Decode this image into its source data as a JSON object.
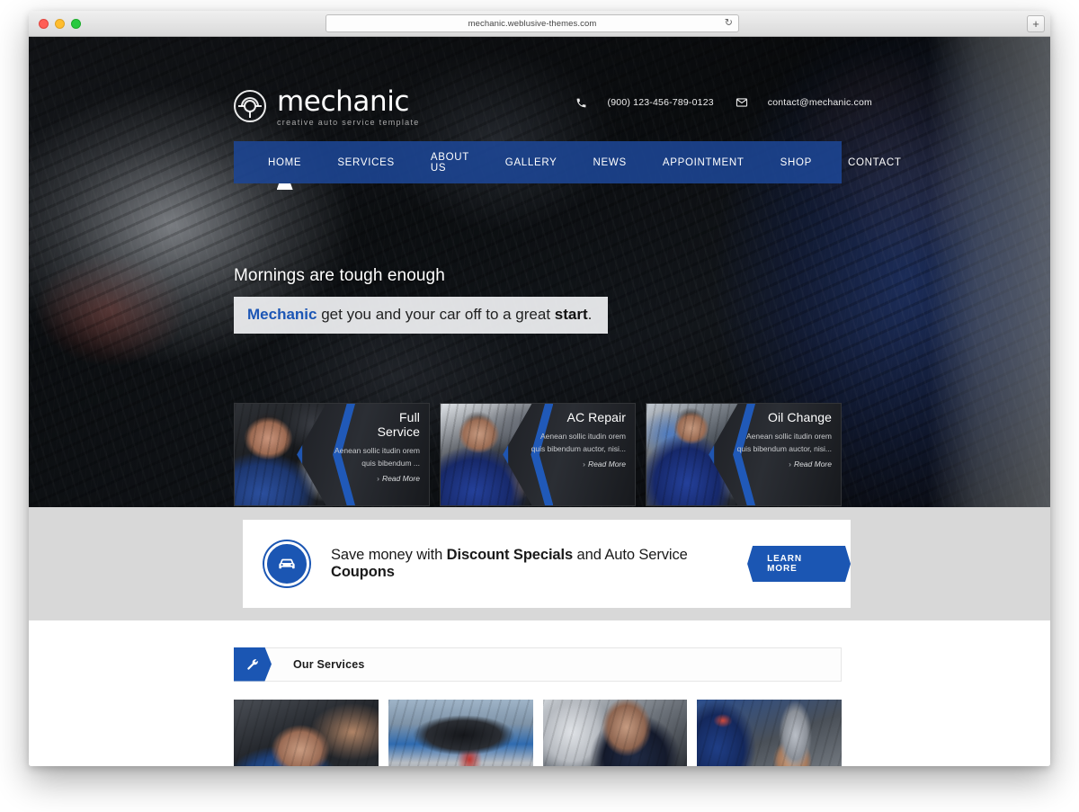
{
  "browser": {
    "url": "mechanic.weblusive-themes.com",
    "reload_icon": "reload-icon",
    "new_tab_label": "+",
    "traffic_lights": [
      "close",
      "minimize",
      "maximize"
    ]
  },
  "site": {
    "logo_name": "mechanic",
    "logo_tagline": "creative auto service template",
    "logo_icon": "steering-wheel-icon",
    "contact": {
      "phone_icon": "phone-icon",
      "phone": "(900) 123-456-789-0123",
      "email_icon": "envelope-icon",
      "email": "contact@mechanic.com"
    },
    "nav": [
      {
        "label": "HOME",
        "active": true
      },
      {
        "label": "SERVICES",
        "active": false
      },
      {
        "label": "ABOUT US",
        "active": false
      },
      {
        "label": "GALLERY",
        "active": false
      },
      {
        "label": "NEWS",
        "active": false
      },
      {
        "label": "APPOINTMENT",
        "active": false
      },
      {
        "label": "SHOP",
        "active": false
      },
      {
        "label": "CONTACT",
        "active": false
      }
    ],
    "accent_color": "#1b56b3",
    "nav_color": "#1d4694",
    "band_color": "#d8d8d8"
  },
  "hero": {
    "line1": "Mornings are tough enough",
    "caption_brand": "Mechanic",
    "caption_mid": " get you and your car off to a great ",
    "caption_kw": "start",
    "caption_end": "."
  },
  "cards": [
    {
      "title": "Full Service",
      "title_l1": "Full",
      "title_l2": "Service",
      "desc": "Aenean sollic itudin orem quis bibendum  ...",
      "more": "Read More",
      "more_chevron": "›"
    },
    {
      "title": "AC Repair",
      "title_l1": "AC Repair",
      "title_l2": "",
      "desc": "Aenean sollic itudin orem quis bibendum auctor, nisi...",
      "more": "Read More",
      "more_chevron": "›"
    },
    {
      "title": "Oil Change",
      "title_l1": "Oil Change",
      "title_l2": "",
      "desc": "Aenean sollic itudin orem quis bibendum auctor, nisi...",
      "more": "Read More",
      "more_chevron": "›"
    }
  ],
  "coupon": {
    "icon": "car-icon",
    "text_1": "Save money with ",
    "bold_1": "Discount Specials",
    "text_2": " and Auto Service ",
    "bold_2": "Coupons",
    "button_label": "LEARN MORE"
  },
  "services": {
    "tab_icon": "wrench-icon",
    "title": "Our Services",
    "thumbs": [
      {
        "name": "mechanic-under-car-thumb"
      },
      {
        "name": "car-on-lift-thumb"
      },
      {
        "name": "mechanic-engine-bay-thumb"
      },
      {
        "name": "mechanic-holding-wrench-thumb"
      }
    ]
  }
}
